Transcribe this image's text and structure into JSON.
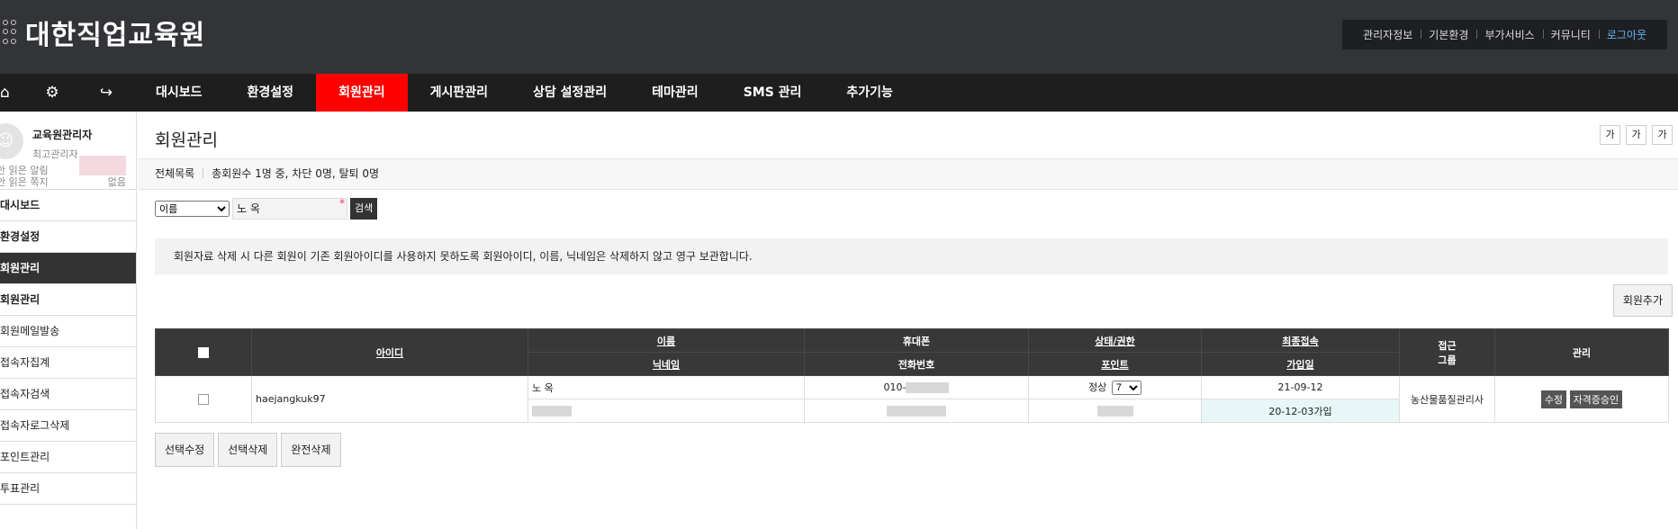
{
  "header": {
    "logo_text": "대한직업교육원",
    "top_links": [
      "관리자정보",
      "기본환경",
      "부가서비스",
      "커뮤니티",
      "로그아웃"
    ]
  },
  "gnb": {
    "menus": [
      "대시보드",
      "환경설정",
      "회원관리",
      "게시판관리",
      "상담 설정관리",
      "테마관리",
      "SMS 관리",
      "추가기능"
    ],
    "active": "회원관리"
  },
  "sidebar": {
    "profile_name": "교육원관리자",
    "profile_role": "최고관리자",
    "unread_alert_label": "안 읽은 알림",
    "unread_msg_label": "안 읽은 쪽지",
    "unread_msg_value": "없음",
    "items": [
      {
        "label": "대시보드",
        "type": "grp"
      },
      {
        "label": "환경설정",
        "type": "grp"
      },
      {
        "label": "회원관리",
        "type": "on"
      },
      {
        "label": "회원관리",
        "type": "grp"
      },
      {
        "label": "회원메일발송",
        "type": "sub"
      },
      {
        "label": "접속자집계",
        "type": "sub"
      },
      {
        "label": "접속자검색",
        "type": "sub"
      },
      {
        "label": "접속자로그삭제",
        "type": "sub"
      },
      {
        "label": "포인트관리",
        "type": "sub"
      },
      {
        "label": "투표관리",
        "type": "sub"
      }
    ]
  },
  "content": {
    "title": "회원관리",
    "font_buttons": [
      "가",
      "가",
      "가"
    ],
    "summary_all": "전체목록",
    "summary_text": "총회원수 1명 중, 차단 0명, 탈퇴 0명",
    "search_field": "이름",
    "search_value": "노 옥",
    "search_button": "검색",
    "notice": "회원자료 삭제 시 다른 회원이 기존 회원아이디를 사용하지 못하도록 회원아이디, 이름, 닉네임은 삭제하지 않고 영구 보관합니다.",
    "add_button": "회원추가"
  },
  "table": {
    "headers": {
      "id": "아이디",
      "name": "이름",
      "nick": "닉네임",
      "hp": "휴대폰",
      "tel": "전화번호",
      "status": "상태/권한",
      "point": "포인트",
      "last": "최종접속",
      "join": "가입일",
      "group": "접근\n그룹",
      "manage": "관리"
    },
    "row": {
      "id": "haejangkuk97",
      "name": "노 옥",
      "hp": "010-",
      "status": "정상",
      "level": "7",
      "last_login": "21-09-12",
      "join_date": "20-12-03가입",
      "group": "농산물품질관리사",
      "btn_edit": "수정",
      "btn_cert": "자격증승인"
    }
  },
  "bottom_buttons": [
    "선택수정",
    "선택삭제",
    "완전삭제"
  ]
}
